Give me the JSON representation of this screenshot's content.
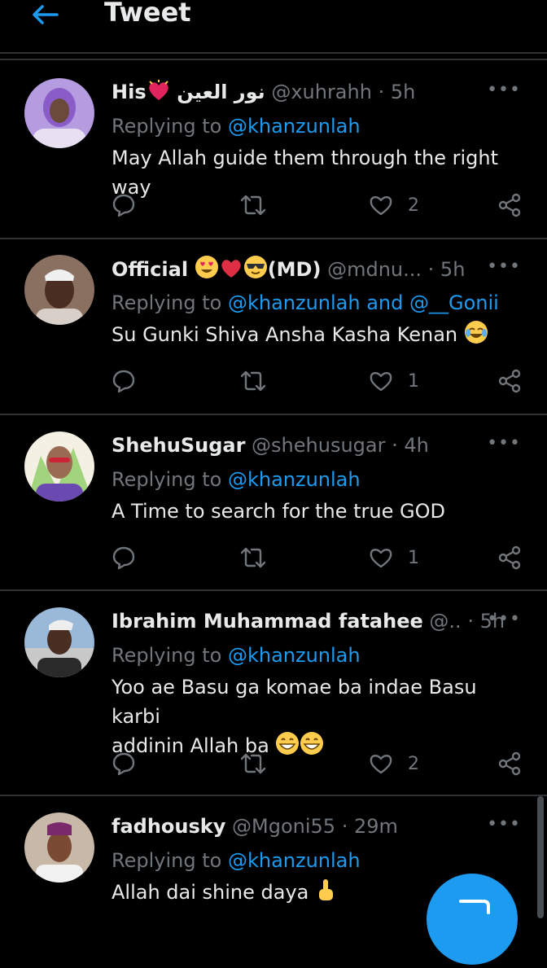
{
  "header": {
    "title": "Tweet"
  },
  "tweets": [
    {
      "display_name": "His",
      "name_suffix": "نور العين",
      "handle": "@xuhrahh",
      "time": "5h",
      "replying_prefix": "Replying to",
      "replying_to": "@khanzunlah",
      "text": "May Allah guide them through the right way",
      "likes": "2"
    },
    {
      "display_name": "Official",
      "name_suffix": "(MD)",
      "handle": "@mdnu...",
      "time": "5h",
      "replying_prefix": "Replying to",
      "replying_to": "@khanzunlah and @__Gonii",
      "text": "Su Gunki Shiva Ansha Kasha Kenan",
      "likes": "1"
    },
    {
      "display_name": "ShehuSugar",
      "handle": "@shehusugar",
      "time": "4h",
      "replying_prefix": "Replying to",
      "replying_to": "@khanzunlah",
      "text": "A Time to search for the true GOD",
      "likes": "1"
    },
    {
      "display_name": "Ibrahim Muhammad fatahee",
      "handle": "@..",
      "time": "5h",
      "replying_prefix": "Replying to",
      "replying_to": "@khanzunlah",
      "text_line1": "Yoo ae Basu ga komae ba indae Basu karbi",
      "text_line2": "addinin Allah ba",
      "likes": "2"
    },
    {
      "display_name": "fadhousky",
      "handle": "@Mgoni55",
      "time": "29m",
      "replying_prefix": "Replying to",
      "replying_to": "@khanzunlah",
      "text": "Allah dai shine daya"
    }
  ],
  "ui": {
    "more": "•••",
    "sep": "·"
  },
  "colors": {
    "accent": "#1d9bf0",
    "muted": "#71767b",
    "divider": "#2f3336",
    "background": "#000000"
  },
  "icons": [
    "back-arrow-icon",
    "reply-icon",
    "retweet-icon",
    "like-icon",
    "share-icon",
    "more-icon",
    "compose-fab"
  ]
}
